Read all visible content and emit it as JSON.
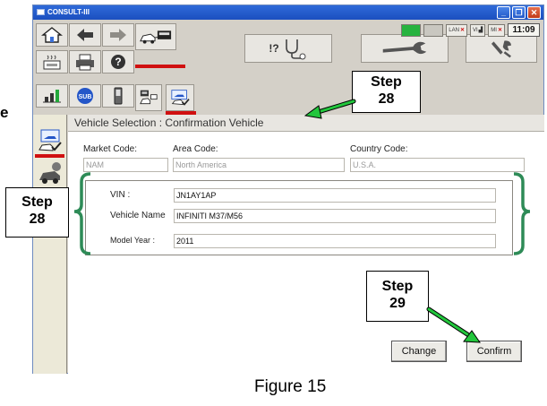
{
  "window": {
    "title": "CONSULT-III",
    "minimize_glyph": "_",
    "restore_glyph": "❐",
    "close_glyph": "✕"
  },
  "status": {
    "lan_label": "LAN",
    "vi_label": "VI",
    "mi_label": "MI",
    "clock": "11:09"
  },
  "toolbar": {
    "diagnosis_label": "!?",
    "sub_label": "SUB"
  },
  "page": {
    "title": "Vehicle Selection : Confirmation Vehicle"
  },
  "codes": {
    "market_label": "Market Code:",
    "market_value": "NAM",
    "area_label": "Area Code:",
    "area_value": "North America",
    "country_label": "Country Code:",
    "country_value": "U.S.A."
  },
  "vehicle": {
    "vin_label": "VIN :",
    "vin_value": "JN1AY1AP",
    "name_label": "Vehicle Name",
    "name_value": "INFINITI M37/M56",
    "year_label": "Model Year :",
    "year_value": "2011"
  },
  "buttons": {
    "change": "Change",
    "confirm": "Confirm"
  },
  "annotations": {
    "step_top": [
      "Step",
      "28"
    ],
    "step_left": [
      "Step",
      "28"
    ],
    "step_bottom": [
      "Step",
      "29"
    ],
    "stray_letter": "e",
    "caption": "Figure 15"
  },
  "colors": {
    "arrow_green": "#22c63c",
    "bracket_green": "#2e8b57",
    "titlebar_blue": "#2f6ad9",
    "selection_red": "#d01010"
  }
}
